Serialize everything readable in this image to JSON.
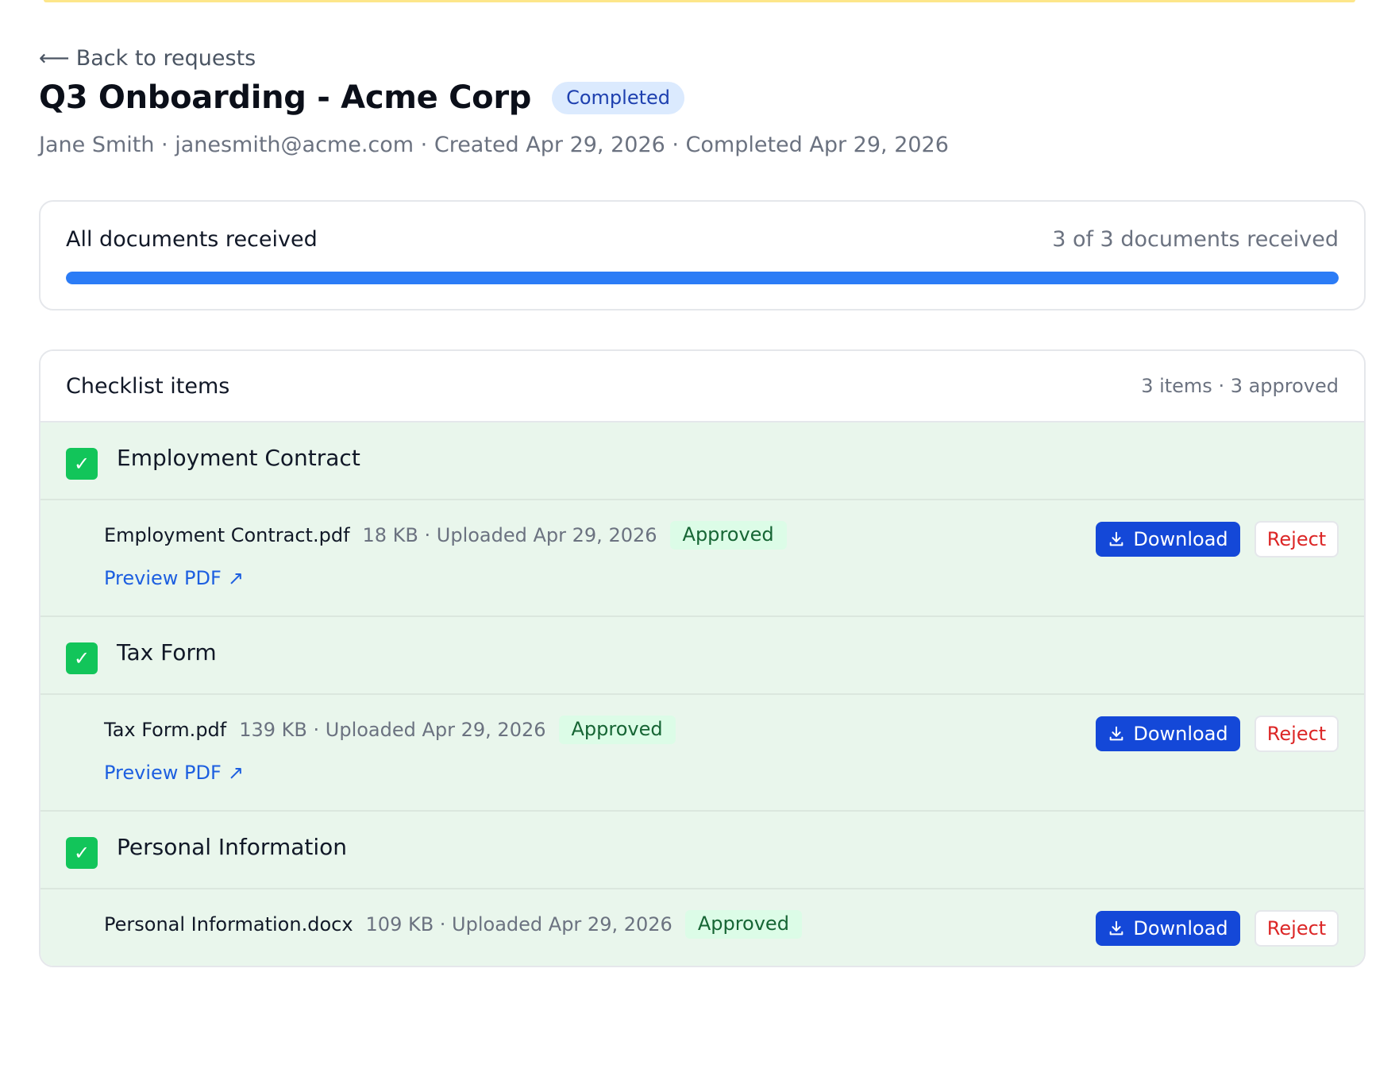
{
  "header": {
    "back_label": "Back to requests",
    "back_arrow": "⟵",
    "title": "Q3 Onboarding - Acme Corp",
    "status": "Completed",
    "meta": "Jane Smith · janesmith@acme.com · Created Apr 29, 2026 · Completed Apr 29, 2026"
  },
  "progress": {
    "label": "All documents received",
    "count_text": "3 of 3 documents received",
    "fraction": 1.0
  },
  "checklist": {
    "title": "Checklist items",
    "summary": "3 items · 3 approved",
    "items": [
      {
        "name": "Employment Contract",
        "file_name": "Employment Contract.pdf",
        "file_meta": "18 KB · Uploaded Apr 29, 2026",
        "status": "Approved",
        "preview_label": "Preview PDF",
        "download_label": "Download",
        "reject_label": "Reject"
      },
      {
        "name": "Tax Form",
        "file_name": "Tax Form.pdf",
        "file_meta": "139 KB · Uploaded Apr 29, 2026",
        "status": "Approved",
        "preview_label": "Preview PDF",
        "download_label": "Download",
        "reject_label": "Reject"
      },
      {
        "name": "Personal Information",
        "file_name": "Personal Information.docx",
        "file_meta": "109 KB · Uploaded Apr 29, 2026",
        "status": "Approved",
        "download_label": "Download",
        "reject_label": "Reject"
      }
    ]
  },
  "icons": {
    "check": "✓",
    "external": "↗",
    "download": "download-icon"
  },
  "colors": {
    "primary": "#1448d8",
    "progress": "#2b7cf6",
    "success": "#12c55a",
    "danger": "#dc2626",
    "approved_bg": "#e9f6ec",
    "status_pill_bg": "#dbeafe"
  }
}
